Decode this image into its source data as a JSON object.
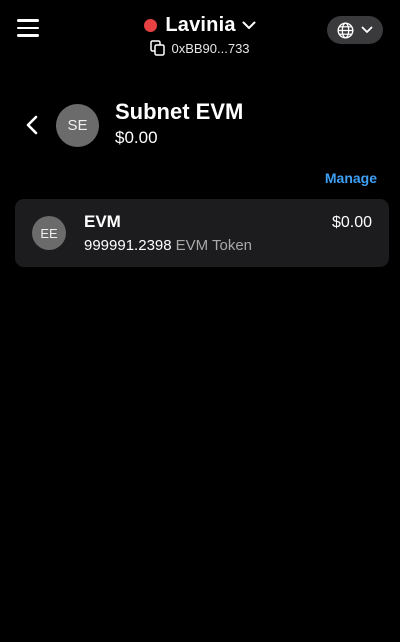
{
  "header": {
    "account_name": "Lavinia",
    "address": "0xBB90...733",
    "status_color": "#e84142"
  },
  "token": {
    "avatar_initials": "SE",
    "name": "Subnet EVM",
    "balance": "$0.00"
  },
  "manage_label": "Manage",
  "assets": [
    {
      "avatar_initials": "EE",
      "name": "EVM",
      "amount": "999991.2398",
      "unit": "EVM Token",
      "value": "$0.00"
    }
  ],
  "colors": {
    "background": "#000000",
    "card": "#1c1c1e",
    "link": "#3ea0f5",
    "avatar": "#6b6b6b"
  },
  "icons": [
    "menu-icon",
    "chevron-down-icon",
    "copy-icon",
    "globe-icon",
    "back-arrow-icon"
  ]
}
